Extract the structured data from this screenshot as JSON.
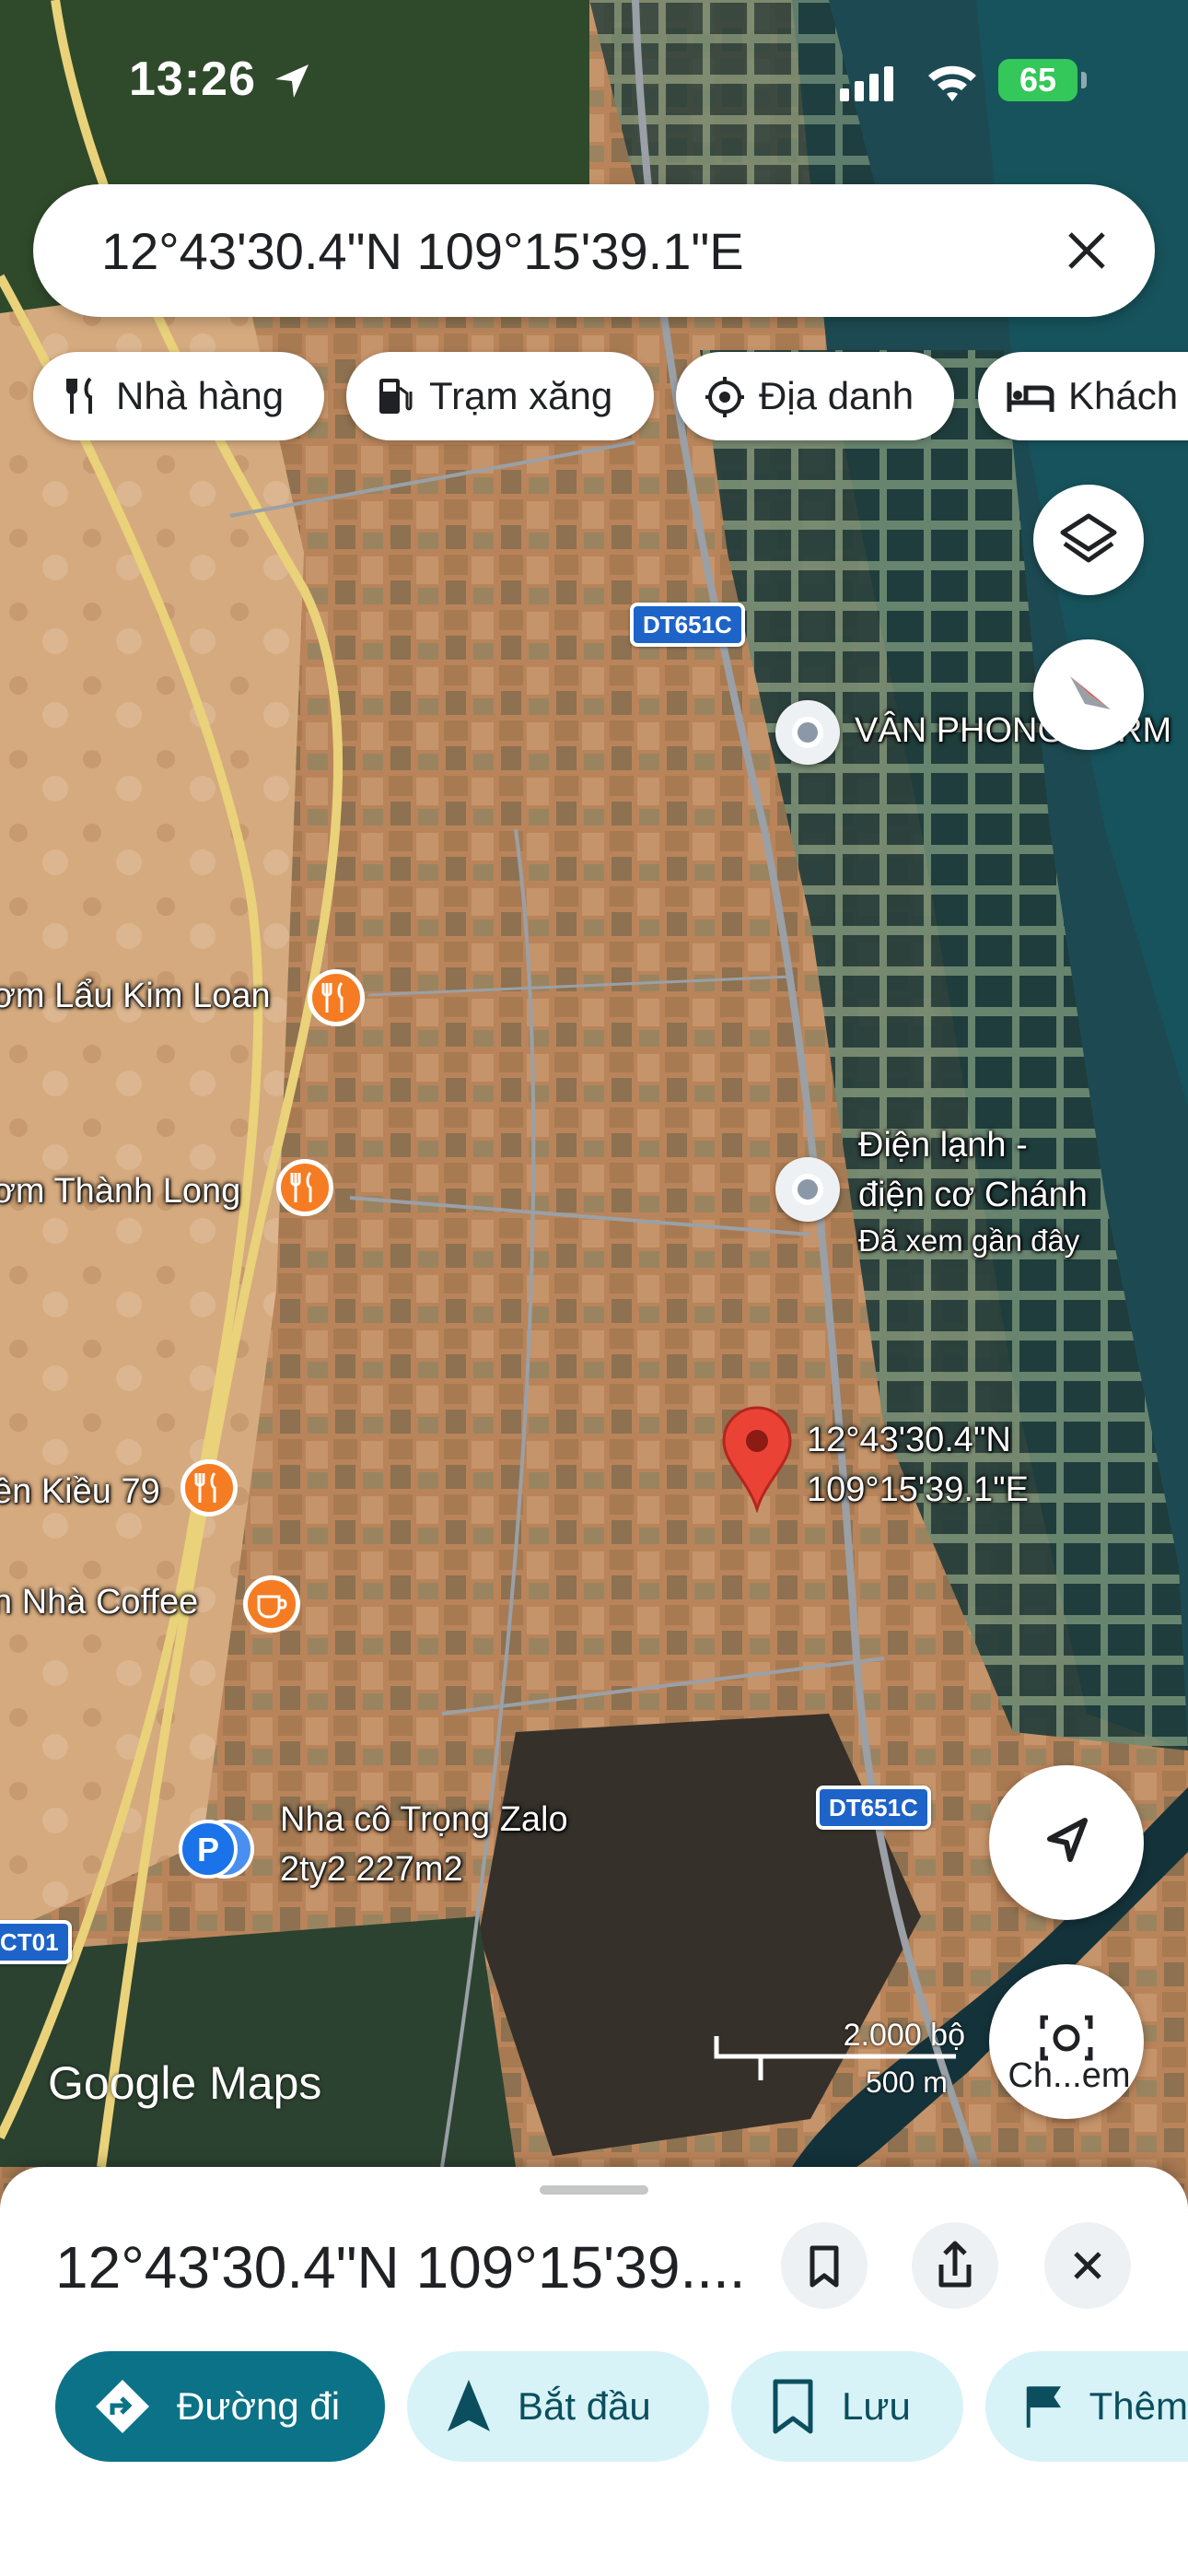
{
  "status_bar": {
    "time": "13:26",
    "battery": "65"
  },
  "search": {
    "query": "12°43'30.4\"N 109°15'39.1\"E"
  },
  "chips": [
    {
      "label": "Nhà hàng",
      "icon": "restaurant-icon"
    },
    {
      "label": "Trạm xăng",
      "icon": "gas-station-icon"
    },
    {
      "label": "Địa danh",
      "icon": "landmark-icon"
    },
    {
      "label": "Khách",
      "icon": "hotel-icon"
    }
  ],
  "map": {
    "pois": [
      {
        "name": "VÂN PHONG FARM",
        "type": "gray-pin"
      },
      {
        "name": "Điện lạnh -",
        "name2": "điện cơ Chánh",
        "sub": "Đã xem gần đây",
        "type": "gray-pin"
      },
      {
        "name": "ơm Lẩu Kim Loan",
        "type": "restaurant"
      },
      {
        "name": "ơm Thành Long",
        "type": "restaurant"
      },
      {
        "name": "ên Kiều 79",
        "type": "restaurant"
      },
      {
        "name": "n Nhà Coffee",
        "type": "cafe"
      },
      {
        "name": "Nha cô Trọng Zalo",
        "name2": "2ty2  227m2",
        "type": "parking"
      }
    ],
    "dropped_pin": {
      "line1": "12°43'30.4\"N",
      "line2": "109°15'39.1\"E"
    },
    "road_shields": [
      "DT651C",
      "DT651C",
      "CT01"
    ],
    "brand": "Google Maps",
    "scale": {
      "imperial": "2.000 bộ",
      "metric": "500 m"
    },
    "camera_label": "Ch...em"
  },
  "sheet": {
    "title": "12°43'30.4\"N 109°15'39....",
    "actions": [
      {
        "label": "Đường đi"
      },
      {
        "label": "Bắt đầu"
      },
      {
        "label": "Lưu"
      },
      {
        "label": "Thêm"
      }
    ]
  }
}
